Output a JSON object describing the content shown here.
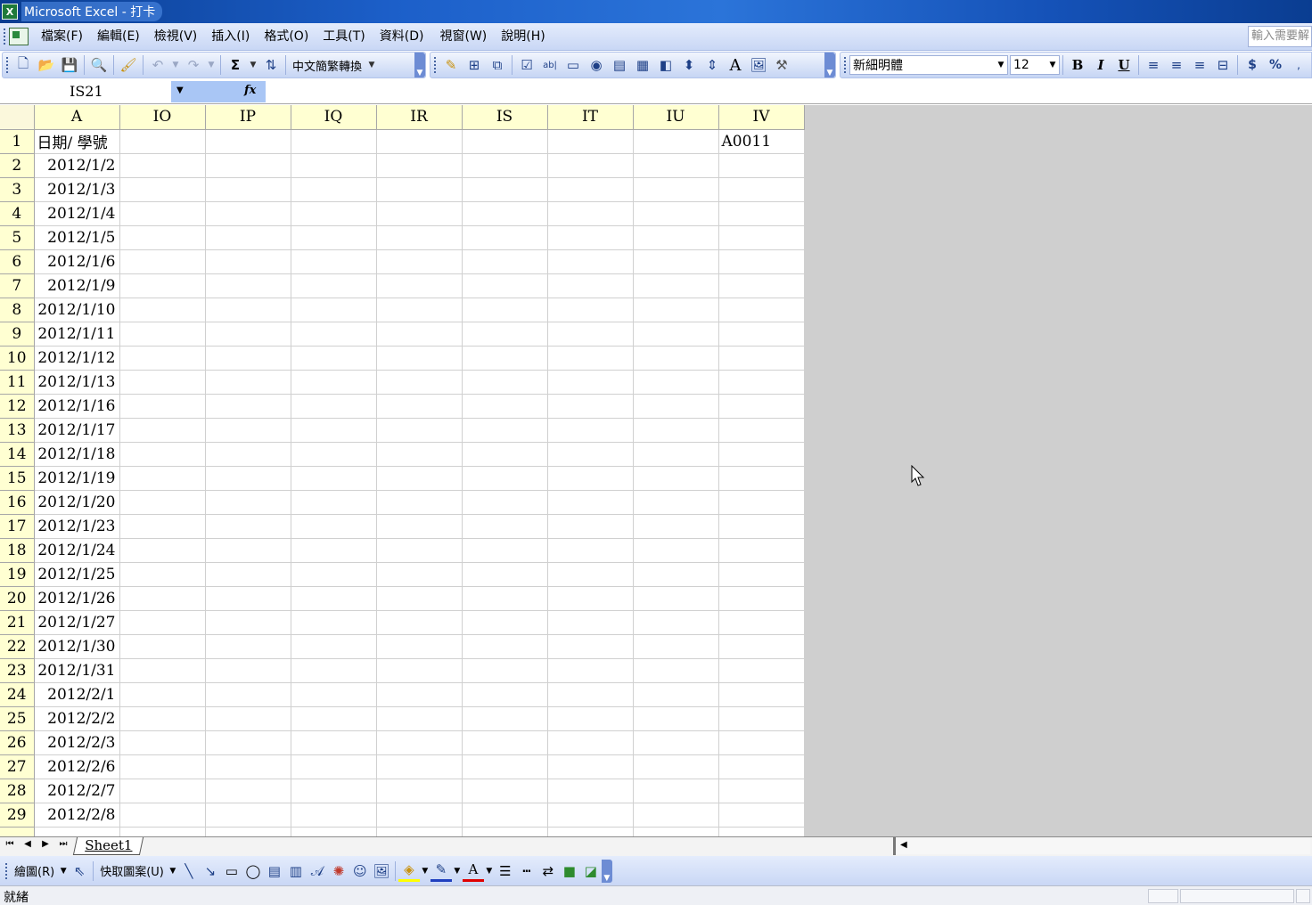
{
  "window": {
    "title": "Microsoft Excel - 打卡",
    "app_icon": "excel-icon"
  },
  "menu": {
    "items": [
      "檔案(F)",
      "編輯(E)",
      "檢視(V)",
      "插入(I)",
      "格式(O)",
      "工具(T)",
      "資料(D)",
      "視窗(W)",
      "說明(H)"
    ],
    "help_placeholder": "輸入需要解"
  },
  "toolbar": {
    "conversion_label": "中文簡繁轉換",
    "font_name": "新細明體",
    "font_size": "12",
    "bold": "B",
    "italic": "I",
    "underline": "U",
    "currency": "$",
    "percent": "%"
  },
  "formula_bar": {
    "name_box": "IS21",
    "fx": "fx",
    "formula": ""
  },
  "sheet": {
    "corner": "",
    "columns": [
      "A",
      "IO",
      "IP",
      "IQ",
      "IR",
      "IS",
      "IT",
      "IU",
      "IV"
    ],
    "header_row": {
      "A": "日期/ 學號",
      "IV": "A0011"
    },
    "row_numbers": [
      "1",
      "2",
      "3",
      "4",
      "5",
      "6",
      "7",
      "8",
      "9",
      "10",
      "11",
      "12",
      "13",
      "14",
      "15",
      "16",
      "17",
      "18",
      "19",
      "20",
      "21",
      "22",
      "23",
      "24",
      "25",
      "26",
      "27",
      "28",
      "29"
    ],
    "dates": [
      "2012/1/2",
      "2012/1/3",
      "2012/1/4",
      "2012/1/5",
      "2012/1/6",
      "2012/1/9",
      "2012/1/10",
      "2012/1/11",
      "2012/1/12",
      "2012/1/13",
      "2012/1/16",
      "2012/1/17",
      "2012/1/18",
      "2012/1/19",
      "2012/1/20",
      "2012/1/23",
      "2012/1/24",
      "2012/1/25",
      "2012/1/26",
      "2012/1/27",
      "2012/1/30",
      "2012/1/31",
      "2012/2/1",
      "2012/2/2",
      "2012/2/3",
      "2012/2/6",
      "2012/2/7",
      "2012/2/8"
    ]
  },
  "tabs": {
    "sheet_name": "Sheet1"
  },
  "drawing": {
    "draw_label": "繪圖(R)",
    "autoshapes_label": "快取圖案(U)"
  },
  "status": {
    "text": "就緒"
  }
}
